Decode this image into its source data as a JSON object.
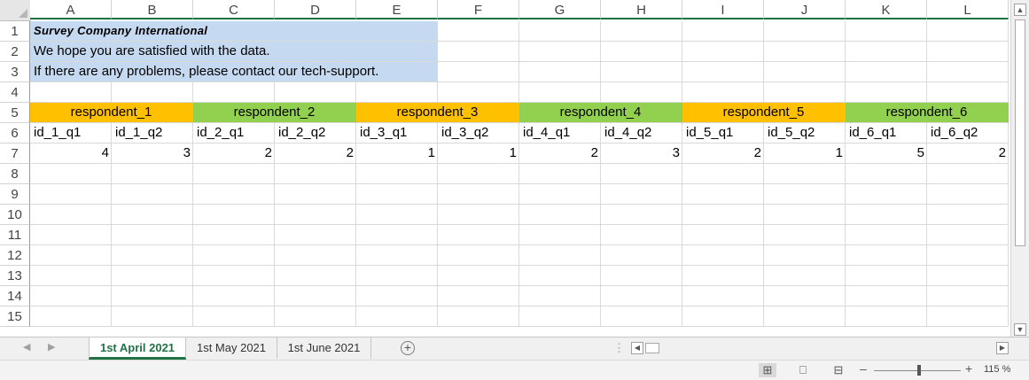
{
  "columns": [
    "A",
    "B",
    "C",
    "D",
    "E",
    "F",
    "G",
    "H",
    "I",
    "J",
    "K",
    "L"
  ],
  "rows": [
    "1",
    "2",
    "3",
    "4",
    "5",
    "6",
    "7",
    "8",
    "9",
    "10",
    "11",
    "12",
    "13",
    "14",
    "15"
  ],
  "cells": {
    "title": "Survey Company International",
    "line2": "We hope you are satisfied with the data.",
    "line3": "If there are any problems, please contact our tech-support."
  },
  "respondents": [
    "respondent_1",
    "respondent_2",
    "respondent_3",
    "respondent_4",
    "respondent_5",
    "respondent_6"
  ],
  "question_ids": [
    "id_1_q1",
    "id_1_q2",
    "id_2_q1",
    "id_2_q2",
    "id_3_q1",
    "id_3_q2",
    "id_4_q1",
    "id_4_q2",
    "id_5_q1",
    "id_5_q2",
    "id_6_q1",
    "id_6_q2"
  ],
  "answers": [
    "4",
    "3",
    "2",
    "2",
    "1",
    "1",
    "2",
    "3",
    "2",
    "1",
    "5",
    "2"
  ],
  "colors": {
    "orange": "#ffc000",
    "green": "#92d050",
    "light_blue": "#c5d9f1",
    "excel_green": "#217346"
  },
  "sheets": {
    "tabs": [
      "1st April 2021",
      "1st May 2021",
      "1st June 2021"
    ],
    "active": "1st April 2021"
  },
  "status": {
    "zoom": "115 %",
    "zoom_minus": "–",
    "zoom_plus": "+",
    "view_modes": [
      "normal-view-icon",
      "page-layout-icon",
      "page-break-preview-icon"
    ],
    "view_mode_glyphs": [
      "⊞",
      "⎕",
      "⊟"
    ]
  },
  "icons": {
    "add_sheet": "+",
    "scroll_up": "▲",
    "scroll_down": "▼",
    "scroll_left": "◀",
    "scroll_right": "▶",
    "tab_prev": "◀",
    "tab_next": "▶",
    "dots": "⋮"
  }
}
